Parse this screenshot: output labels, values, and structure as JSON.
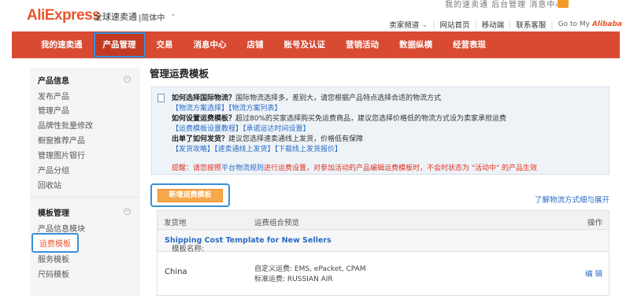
{
  "header": {
    "logo": "AliExpress",
    "logo_sub": "全球速卖通",
    "language": "|简体中",
    "faded_top": "我的速卖通  后台管理  消息中心",
    "links": [
      "卖家频道",
      "网站首页",
      "移动端",
      "联系客服"
    ],
    "goto_prefix": "Go to My",
    "goto_brand": "Alibaba",
    "accent": "#e8552d"
  },
  "nav": {
    "items": [
      "我的速卖通",
      "产品管理",
      "交易",
      "消息中心",
      "店铺",
      "账号及认证",
      "营销活动",
      "数据纵横",
      "经营表现"
    ],
    "active_index": 1,
    "bg": "#d94a32"
  },
  "sidebar": {
    "sections": [
      {
        "title": "产品信息",
        "items": [
          "发布产品",
          "管理产品",
          "品牌性批量修改",
          "橱窗推荐产品",
          "管理图片银行",
          "产品分组",
          "回收站"
        ]
      },
      {
        "title": "模板管理",
        "items": [
          "产品信息模块",
          "运费模板",
          "服务模板",
          "尺码模板"
        ]
      }
    ],
    "active_item": "运费模板"
  },
  "main": {
    "title": "管理运费模板",
    "info": {
      "q1": "如何选择国际物流？",
      "q1_text": "国际物流选择多，差别大，请您根据产品特点选择合适的物流方式",
      "q1_links": "【物流方案选择】【物流方案列表】",
      "q2": "如何设置运费模板？",
      "q2_text": "超过80%的买家选择购买免运费商品，建议您选择价格低的物流方式设为卖家承担运费",
      "q2_links": "【运费模板设置教程】【承诺运达时间设置】",
      "q3": "出单了如何发货？",
      "q3_text": "建议您选择速卖通线上发货，价格低有保障",
      "q3_links": "【发货攻略】【速卖通线上发货】【下载线上发货报价】",
      "warn_pre": "提醒：请您按照",
      "warn_link": "平台物流规则",
      "warn_post": "进行运费设置，对参加活动的产品编辑运费模板时，不会时状态为 \"活动中\" 的产品生效"
    },
    "new_button": "新增运费模板",
    "learn_link": "了解物流方式细与展开",
    "table": {
      "headers": [
        "发货地",
        "运费组合预览",
        "操作"
      ],
      "template_label": "模板名称:",
      "template_name": "Shipping Cost Template for New Sellers",
      "rows": [
        {
          "country": "China",
          "combo_line1": "自定义运费: EMS, ePacket, CPAM",
          "combo_line2": "标准运费: RUSSIAN AIR",
          "ops": "编 辑"
        }
      ]
    }
  }
}
